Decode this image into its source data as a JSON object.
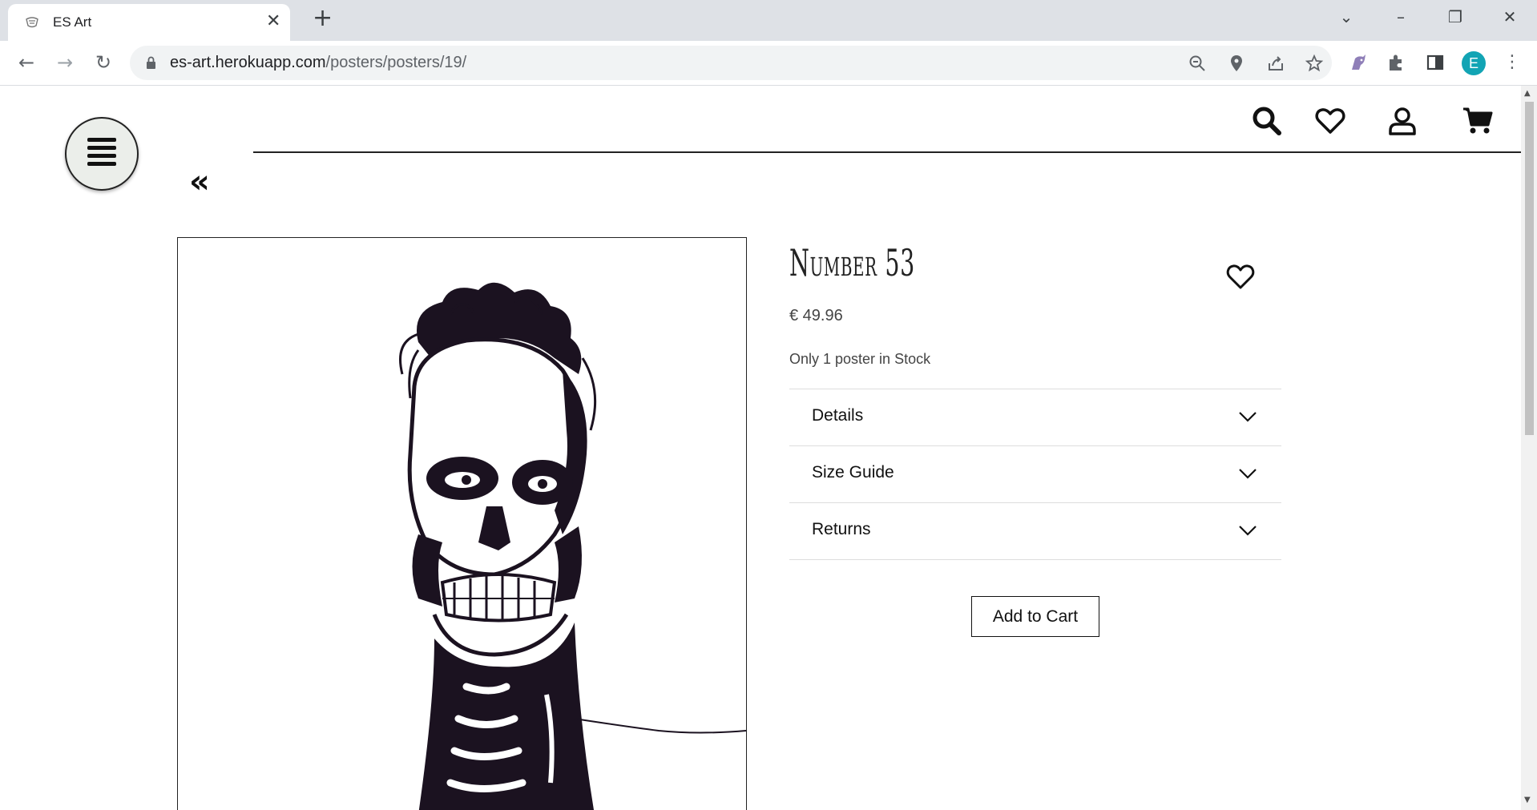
{
  "browser": {
    "tab_title": "ES Art",
    "url_host": "es-art.herokuapp.com",
    "url_path": "/posters/posters/19/",
    "profile_initial": "E"
  },
  "page": {
    "back_symbol": "«",
    "product": {
      "title": "Number 53",
      "price": "€ 49.96",
      "stock": "Only 1 poster in Stock",
      "accordion": [
        {
          "label": "Details"
        },
        {
          "label": "Size Guide"
        },
        {
          "label": "Returns"
        }
      ],
      "add_to_cart": "Add to Cart"
    }
  },
  "icons": {
    "header": [
      "search-icon",
      "heart-icon",
      "user-icon",
      "cart-icon"
    ]
  },
  "colors": {
    "tabstrip": "#dee1e6",
    "omnibox": "#f1f3f4",
    "profile": "#12a4b4",
    "burger_bg": "#ebeeea"
  }
}
